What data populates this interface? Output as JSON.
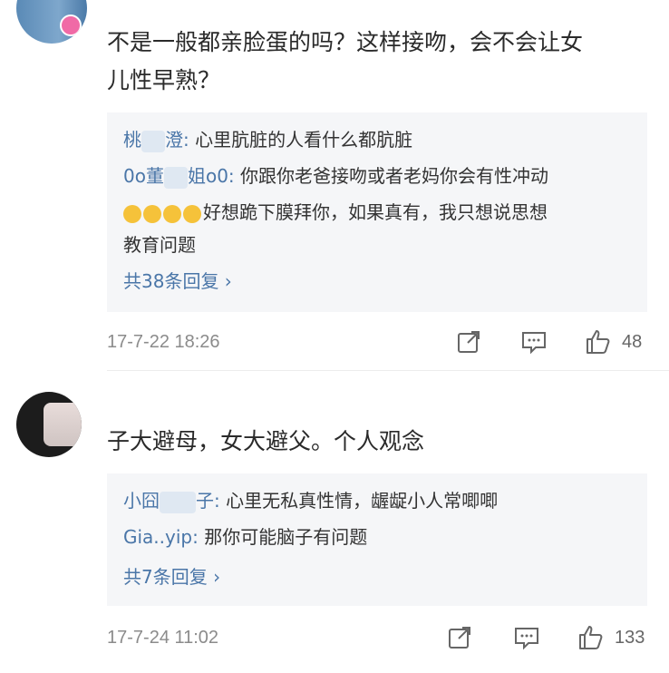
{
  "comments": [
    {
      "text_line1": "不是一般都亲脸蛋的吗？这样接吻，会不会让女",
      "text_line2": "儿性早熟？",
      "replies": [
        {
          "name": "桃",
          "name_tail": "澄:",
          "text": "心里肮脏的人看什么都肮脏"
        },
        {
          "name": "0o董",
          "name_tail": "姐o0:",
          "text": "你跟你老爸接吻或者老妈你会有性冲动"
        },
        {
          "text": "好想跪下膜拜你，如果真有，我只想说思想"
        },
        {
          "text": "教育问题"
        }
      ],
      "more": "共38条回复 ›",
      "time": "17-7-22 18:26",
      "likes": "48"
    },
    {
      "text": "子大避母，女大避父。个人观念",
      "replies": [
        {
          "name": "小囧",
          "name_tail": "子:",
          "text": "心里无私真性情，龌龊小人常唧唧"
        },
        {
          "name": "Gia.",
          "name_tail": ".yip:",
          "text": "那你可能脑子有问题"
        }
      ],
      "more": "共7条回复 ›",
      "time": "17-7-24 11:02",
      "likes": "133"
    }
  ],
  "icons": [
    "share-icon",
    "comment-icon",
    "like-icon"
  ]
}
